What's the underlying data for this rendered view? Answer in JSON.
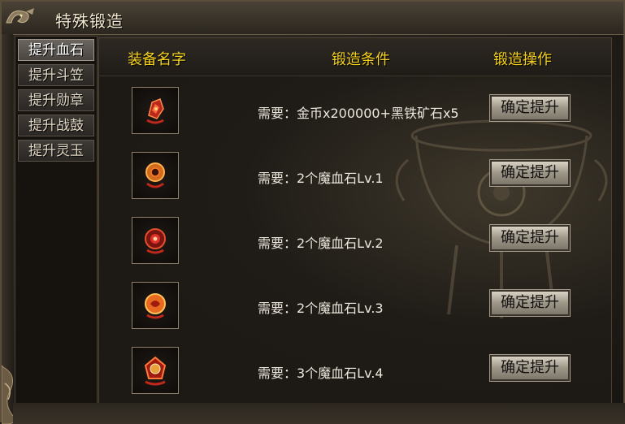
{
  "window": {
    "title": "特殊锻造"
  },
  "tabs": [
    {
      "label": "提升血石",
      "active": true
    },
    {
      "label": "提升斗笠",
      "active": false
    },
    {
      "label": "提升勋章",
      "active": false
    },
    {
      "label": "提升战鼓",
      "active": false
    },
    {
      "label": "提升灵玉",
      "active": false
    }
  ],
  "table": {
    "headers": {
      "name": "装备名字",
      "condition": "锻造条件",
      "action": "锻造操作"
    },
    "rows": [
      {
        "icon": "blood-stone-icon",
        "condition": "需要：金币x200000+黑铁矿石x5",
        "button": "确定提升"
      },
      {
        "icon": "blood-stone-icon",
        "condition": "需要：2个魔血石Lv.1",
        "button": "确定提升"
      },
      {
        "icon": "blood-stone-icon",
        "condition": "需要：2个魔血石Lv.2",
        "button": "确定提升"
      },
      {
        "icon": "blood-stone-icon",
        "condition": "需要：2个魔血石Lv.3",
        "button": "确定提升"
      },
      {
        "icon": "blood-stone-icon",
        "condition": "需要：3个魔血石Lv.4",
        "button": "确定提升"
      }
    ]
  },
  "colors": {
    "header_text": "#f6d21f",
    "body_text": "#ece7dc",
    "accent_red": "#c0281c"
  }
}
